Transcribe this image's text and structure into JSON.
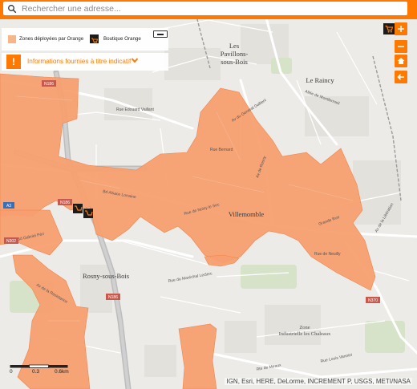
{
  "search": {
    "placeholder": "Rechercher une adresse..."
  },
  "legend": {
    "zones_label": "Zones déployées par Orange",
    "shop_label": "Boutique Orange",
    "zone_color": "#f79f70",
    "shop_icon": "shopping-cart-icon"
  },
  "info": {
    "icon": "exclamation-icon",
    "text": "Informations fournies à titre indicatif"
  },
  "controls": {
    "shop_toggle": "shopping-cart-icon",
    "zoom_in": "+",
    "zoom_out": "−",
    "home": "home-icon",
    "back": "arrow-left-icon"
  },
  "map": {
    "towns": [
      {
        "id": "les-pavillons-line1",
        "text": "Les"
      },
      {
        "id": "les-pavillons-line2",
        "text": "Pavillons-"
      },
      {
        "id": "les-pavillons-line3",
        "text": "sous-Bois"
      },
      {
        "id": "le-raincy",
        "text": "Le Raincy"
      },
      {
        "id": "villemomble",
        "text": "Villemomble"
      },
      {
        "id": "rosny",
        "text": "Rosny-sous-Bois"
      },
      {
        "id": "zone-line1",
        "text": "Zone"
      },
      {
        "id": "zone-line2",
        "text": "Industrielle les Chaleaux"
      }
    ],
    "roads": [
      {
        "id": "rd-schaeffer",
        "text": "Rue Edouard Vaillant"
      },
      {
        "id": "rd-gallieni",
        "text": "Av du General Gallieni"
      },
      {
        "id": "rd-bernard",
        "text": "Rue Bernard"
      },
      {
        "id": "rd-alsace",
        "text": "Bd Alsace Lorraine"
      },
      {
        "id": "rd-noisy",
        "text": "Rue de Noisy le Sec"
      },
      {
        "id": "rd-rosny",
        "text": "Av de Rosny"
      },
      {
        "id": "rd-neuilly",
        "text": "Rue de Neuilly"
      },
      {
        "id": "rd-grande",
        "text": "Grande Rue"
      },
      {
        "id": "rd-gabriel",
        "text": "Bd Gabriel Péri"
      },
      {
        "id": "rd-resistance",
        "text": "Av de la Résistance"
      },
      {
        "id": "rd-louis",
        "text": "Rue Louis Vannini"
      },
      {
        "id": "rd-meaux",
        "text": "Rte de Meaux"
      },
      {
        "id": "rd-thiers",
        "text": "Allée de Montfermeil"
      },
      {
        "id": "rd-leclerc",
        "text": "Rue du Maréchal Leclerc"
      },
      {
        "id": "rd-libert",
        "text": "Av de la Libération"
      }
    ],
    "shields": [
      {
        "id": "n186-north",
        "text": "N186"
      },
      {
        "id": "n186-west",
        "text": "N186"
      },
      {
        "id": "n302",
        "text": "N302"
      },
      {
        "id": "a3",
        "text": "A3"
      },
      {
        "id": "n186-south",
        "text": "N186"
      },
      {
        "id": "n370",
        "text": "N370"
      }
    ]
  },
  "scale": {
    "ticks": [
      "0",
      "0.3",
      "0.6km"
    ]
  },
  "attribution": "IGN, Esri, HERE, DeLorme, INCREMENT P, USGS, METI/NASA"
}
